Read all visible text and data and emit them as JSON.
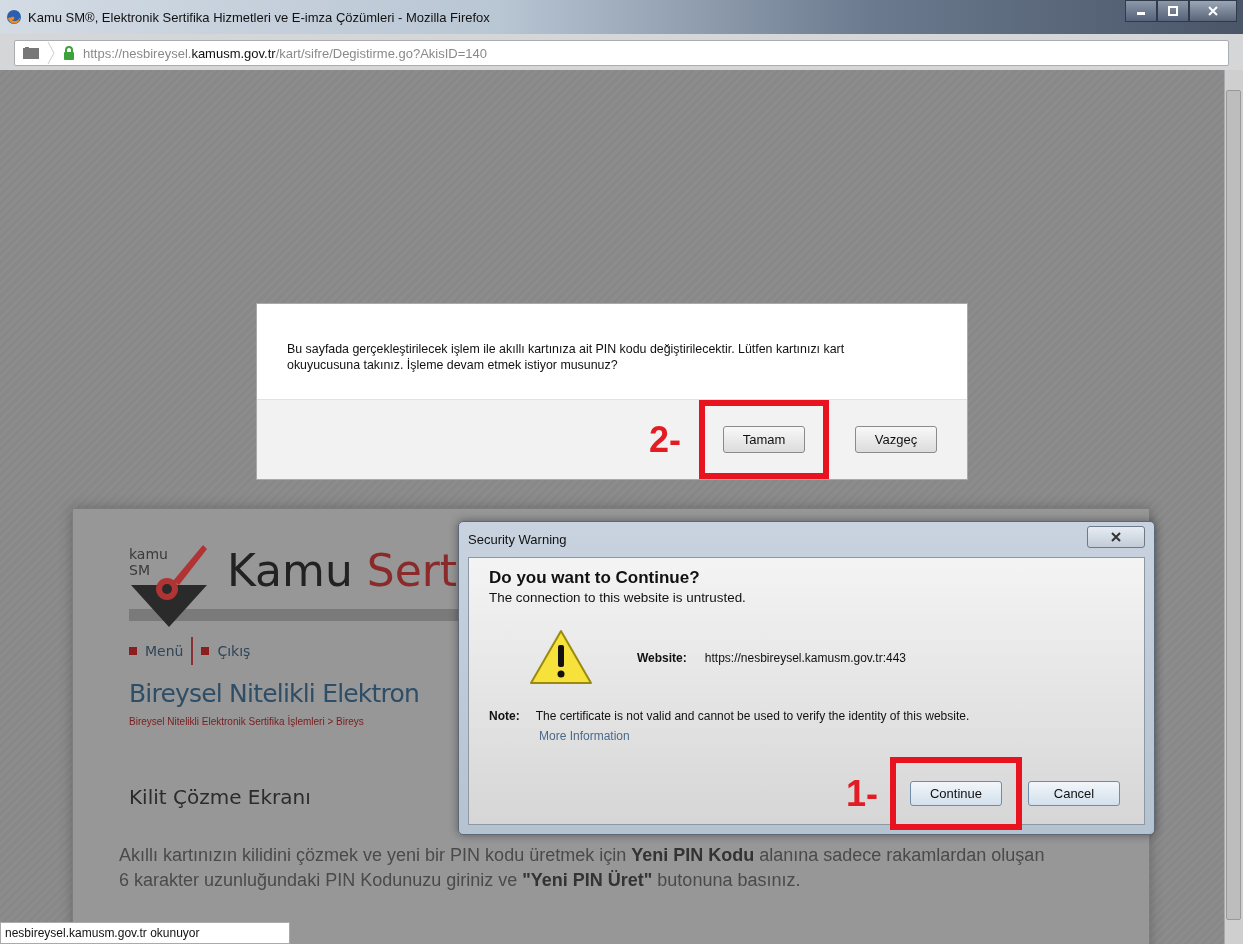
{
  "window": {
    "title": "Kamu SM®, Elektronik Sertifika Hizmetleri ve E-imza Çözümleri - Mozilla Firefox"
  },
  "address_bar": {
    "url_prefix": "https://nesbireysel.",
    "url_domain": "kamusm.gov.tr",
    "url_path": "/kart/sifre/Degistirme.go?AkisID=140",
    "secure": true
  },
  "page": {
    "logo_words": [
      "kamu",
      "SM"
    ],
    "site_title": [
      "Kamu",
      "Sert"
    ],
    "nav": [
      {
        "label": "Menü"
      },
      {
        "label": "Çıkış"
      }
    ],
    "heading": "Bireysel Nitelikli Elektron",
    "breadcrumb": "Bireysel Nitelikli Elektronik Sertifika İşlemleri > Bireys",
    "section_title": "Kilit Çözme Ekranı",
    "instructions": "Akıllı kartınızın kilidini çözmek ve yeni bir PIN kodu üretmek için **Yeni PIN Kodu** alanına sadece rakamlardan oluşan 6 karakter uzunluğundaki PIN Kodunuzu giriniz ve **\"Yeni PIN Üret\"** butonuna basınız."
  },
  "confirm_dialog": {
    "message": "Bu sayfada gerçekleştirilecek işlem ile akıllı kartınıza ait PIN kodu değiştirilecektir. Lütfen kartınızı kart okuyucusuna takınız. İşleme devam etmek istiyor musunuz?",
    "annotation": "2-",
    "buttons": [
      {
        "label": "Tamam",
        "highlighted": true
      },
      {
        "label": "Vazgeç",
        "highlighted": false
      }
    ]
  },
  "security_dialog": {
    "title": "Security Warning",
    "heading": "Do you want to Continue?",
    "subheading": "The connection to this website is untrusted.",
    "website_label": "Website:",
    "website": "https://nesbireysel.kamusm.gov.tr:443",
    "note_label": "Note:",
    "note": "The certificate is not valid and cannot be used to verify the identity of this website.",
    "link": "More Information",
    "annotation": "1-",
    "buttons": [
      {
        "label": "Continue",
        "highlighted": true
      },
      {
        "label": "Cancel",
        "highlighted": false
      }
    ]
  },
  "status_bar": {
    "text": "nesbireysel.kamusm.gov.tr okunuyor"
  }
}
